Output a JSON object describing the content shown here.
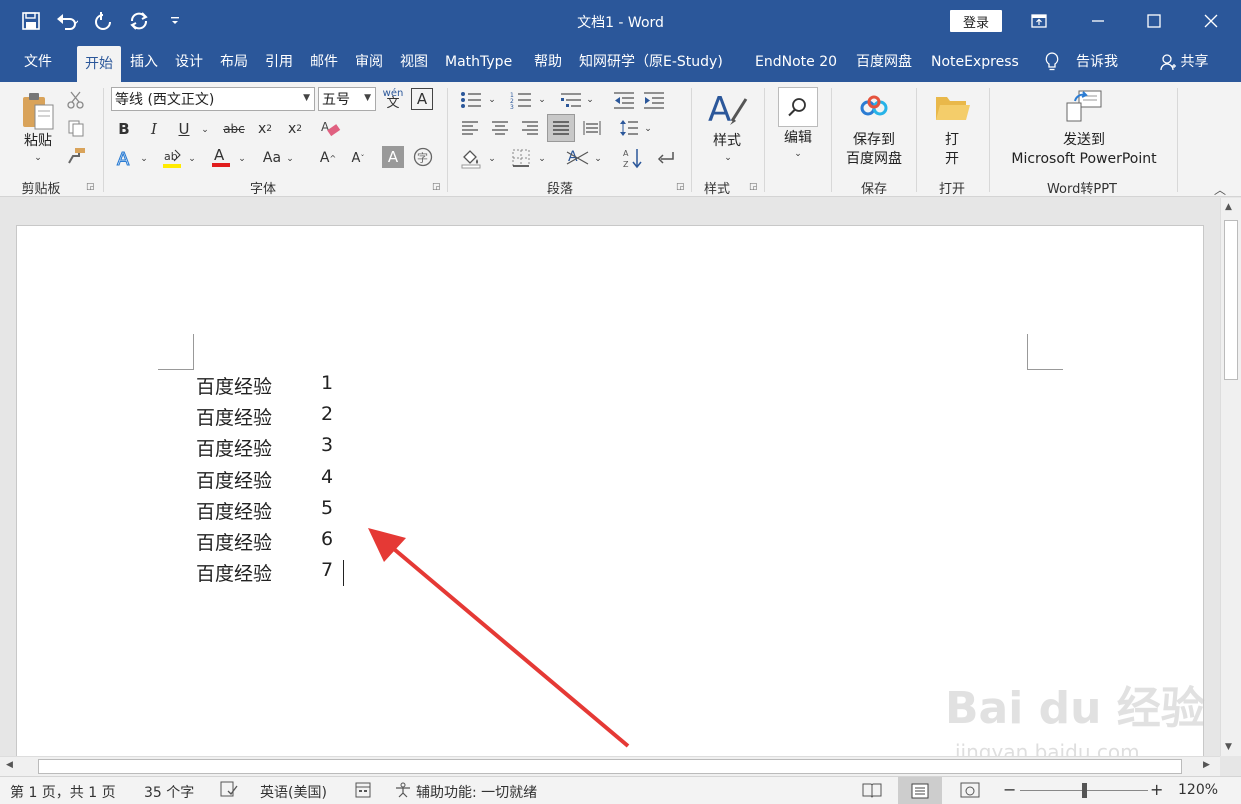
{
  "window": {
    "title": "文档1  -  Word",
    "login_label": "登录"
  },
  "tabs": [
    "文件",
    "开始",
    "插入",
    "设计",
    "布局",
    "引用",
    "邮件",
    "审阅",
    "视图",
    "MathType",
    "帮助",
    "知网研学（原E-Study)",
    "EndNote 20",
    "百度网盘",
    "NoteExpress",
    "告诉我",
    "共享"
  ],
  "active_tab": "开始",
  "ribbon": {
    "clipboard": {
      "paste_label": "粘贴",
      "group_label": "剪贴板"
    },
    "font": {
      "font_name": "等线 (西文正文)",
      "font_size": "五号",
      "group_label": "字体"
    },
    "paragraph": {
      "group_label": "段落"
    },
    "styles": {
      "big_label": "样式",
      "group_label": "样式"
    },
    "editing": {
      "big_label": "编辑"
    },
    "save": {
      "line1": "保存到",
      "line2": "百度网盘",
      "group_label": "保存"
    },
    "open": {
      "line1": "打",
      "line2": "开",
      "group_label": "打开"
    },
    "ppt": {
      "line1": "发送到",
      "line2": "Microsoft PowerPoint",
      "group_label": "Word转PPT"
    }
  },
  "document": {
    "lines": [
      {
        "text": "百度经验",
        "num": "1"
      },
      {
        "text": "百度经验",
        "num": "2"
      },
      {
        "text": "百度经验",
        "num": "3"
      },
      {
        "text": "百度经验",
        "num": "4"
      },
      {
        "text": "百度经验",
        "num": "5"
      },
      {
        "text": "百度经验",
        "num": "6"
      },
      {
        "text": "百度经验",
        "num": "7"
      }
    ]
  },
  "status": {
    "page": "第 1 页，共 1 页",
    "words": "35 个字",
    "language": "英语(美国)",
    "accessibility": "辅助功能: 一切就绪",
    "zoom": "120%"
  },
  "watermark": {
    "logo": "Bai du 经验",
    "url": "jingyan.baidu.com"
  },
  "colors": {
    "accent": "#2b579a",
    "arrow": "#e53935"
  }
}
